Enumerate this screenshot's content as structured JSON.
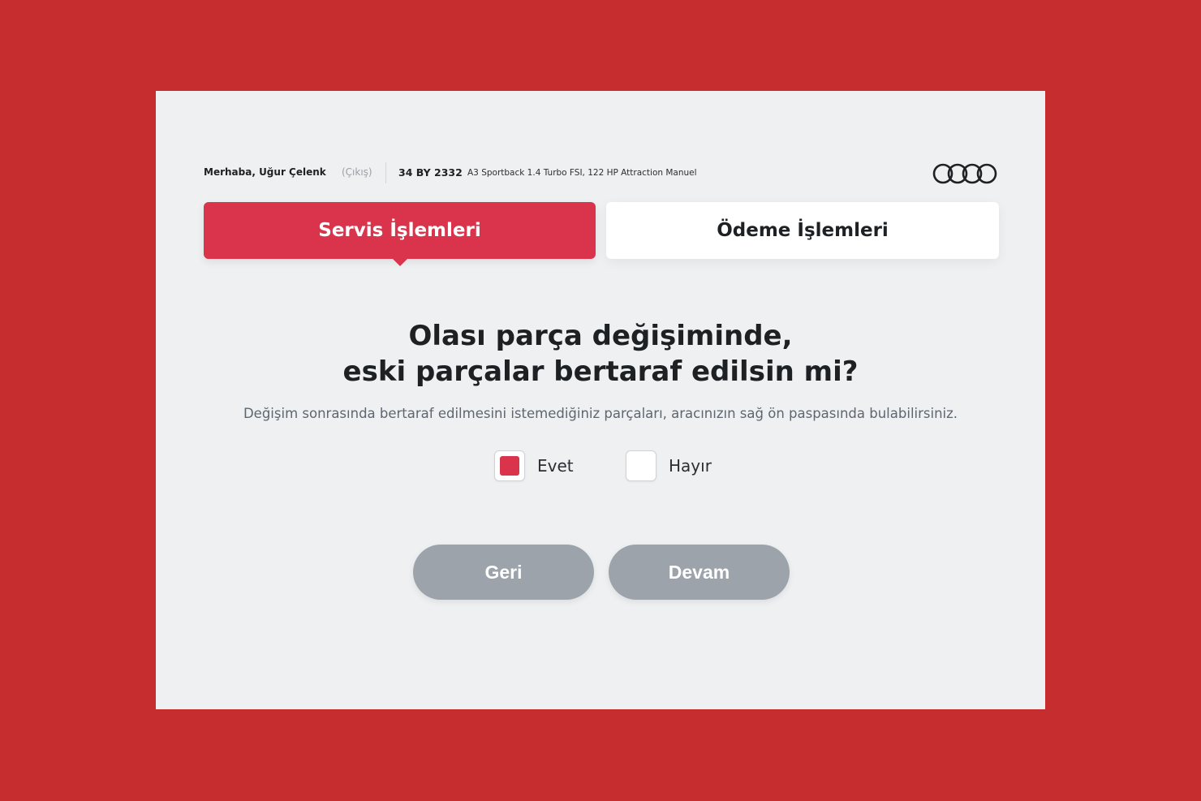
{
  "header": {
    "greeting": "Merhaba, Uğur Çelenk",
    "logout_label": "(Çıkış)",
    "plate": "34 BY 2332",
    "vehicle_model": "A3 Sportback 1.4 Turbo FSI, 122 HP Attraction Manuel",
    "logo_icon": "four-rings-logo-icon"
  },
  "tabs": [
    {
      "label": "Servis İşlemleri",
      "active": true
    },
    {
      "label": "Ödeme İşlemleri",
      "active": false
    }
  ],
  "main": {
    "question_line1": "Olası parça değişiminde,",
    "question_line2": "eski parçalar bertaraf edilsin mi?",
    "subtext": "Değişim sonrasında bertaraf edilmesini istemediğiniz parçaları, aracınızın sağ ön paspasında bulabilirsiniz.",
    "options": [
      {
        "label": "Evet",
        "checked": true
      },
      {
        "label": "Hayır",
        "checked": false
      }
    ]
  },
  "actions": {
    "back_label": "Geri",
    "next_label": "Devam"
  },
  "colors": {
    "frame": "#c62d2f",
    "accent": "#d9344b",
    "panel": "#eef0f2",
    "button_disabled": "#9ca3ab"
  }
}
